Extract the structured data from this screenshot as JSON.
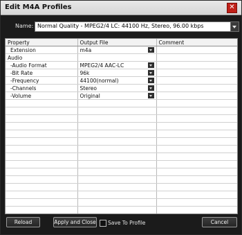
{
  "dialog": {
    "title": "Edit M4A Profiles"
  },
  "name_field": {
    "label": "Name:",
    "value": "Normal Quality - MPEG2/4 LC: 44100 Hz, Stereo, 96.00 kbps"
  },
  "grid": {
    "headers": [
      "Property",
      "Output File",
      "Comment"
    ],
    "rows": [
      {
        "property": "Extension",
        "value": "m4a",
        "comment": "",
        "dropdown": true
      },
      {
        "property": "Audio",
        "value": "",
        "comment": "",
        "dropdown": false
      },
      {
        "property": "-Audio Format",
        "value": "MPEG2/4 AAC-LC",
        "comment": "",
        "dropdown": true
      },
      {
        "property": "-Bit Rate",
        "value": "96k",
        "comment": "",
        "dropdown": true
      },
      {
        "property": "-Frequency",
        "value": "44100(normal)",
        "comment": "",
        "dropdown": true
      },
      {
        "property": "-Channels",
        "value": "Stereo",
        "comment": "",
        "dropdown": true
      },
      {
        "property": "-Volume",
        "value": "Original",
        "comment": "",
        "dropdown": true
      }
    ]
  },
  "footer": {
    "reload": "Reload",
    "apply_close": "Apply and Close",
    "save_to_profile": "Save To Profile",
    "cancel": "Cancel"
  }
}
